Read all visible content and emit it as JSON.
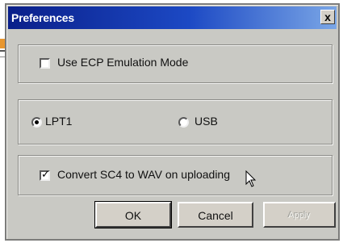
{
  "dialog": {
    "title": "Preferences",
    "close_glyph": "x"
  },
  "options": {
    "ecp_emulation": {
      "label": "Use ECP Emulation Mode",
      "checked": false
    },
    "port": {
      "lpt1_label": "LPT1",
      "usb_label": "USB",
      "selected": "LPT1"
    },
    "convert": {
      "label": "Convert SC4 to WAV on uploading",
      "checked": true
    }
  },
  "buttons": {
    "ok": "OK",
    "cancel": "Cancel",
    "apply": "Apply",
    "apply_enabled": false
  },
  "icons": {
    "cursor": "pointer-cursor-icon",
    "close": "close-icon"
  },
  "colors": {
    "titlebar_start": "#0a1f8a",
    "titlebar_end": "#7aa6e6",
    "dialog_face": "#c9c9c4"
  }
}
